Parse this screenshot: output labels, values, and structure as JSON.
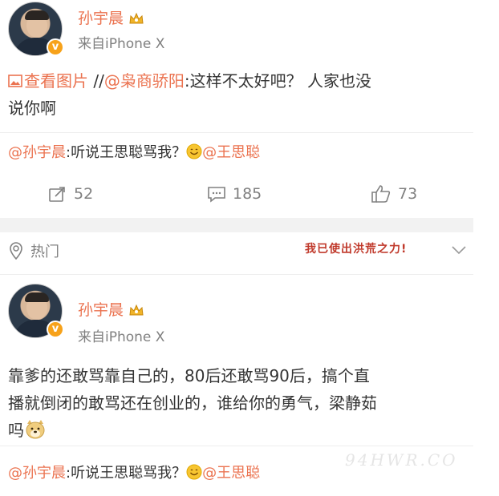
{
  "post1": {
    "user_name": "孙宇晨",
    "source": "来自iPhone X",
    "verified_badge": "v",
    "text_image_link": "查看图片",
    "text_sep": " //",
    "text_mention": "@枭商骄阳",
    "text_body_line1": ":这样不太好吧？   人家也没",
    "text_body_line2": "说你啊",
    "retweet_mention": "@孙宇晨",
    "retweet_body": ":听说王思聪骂我？",
    "retweet_mention2": "@王思聪",
    "repost_count": "52",
    "comment_count": "185",
    "like_count": "73"
  },
  "hot": {
    "label": "热门",
    "sticker_text": "我已使出洪荒之力!"
  },
  "post2": {
    "user_name": "孙宇晨",
    "source": "来自iPhone X",
    "verified_badge": "v",
    "text_line1": "靠爹的还敢骂靠自己的，80后还敢骂90后，搞个直",
    "text_line2": "播就倒闭的敢骂还在创业的，谁给你的勇气，梁静茹",
    "text_line3": "吗",
    "retweet_mention": "@孙宇晨",
    "retweet_body": ":听说王思聪骂我？",
    "retweet_mention2": "@王思聪"
  },
  "watermark": "94HWR.CO",
  "icons": {
    "repost": "repost-icon",
    "comment": "comment-icon",
    "like": "like-icon",
    "hot": "hot-icon",
    "image": "image-icon",
    "chevron": "chevron-down-icon",
    "crown": "vip-crown-icon",
    "smiley": "smiley-emoji-icon",
    "dog": "doge-emoji-icon"
  },
  "colors": {
    "accent": "#eb7350",
    "muted": "#808080",
    "text": "#333333",
    "band": "#f2f2f2"
  }
}
